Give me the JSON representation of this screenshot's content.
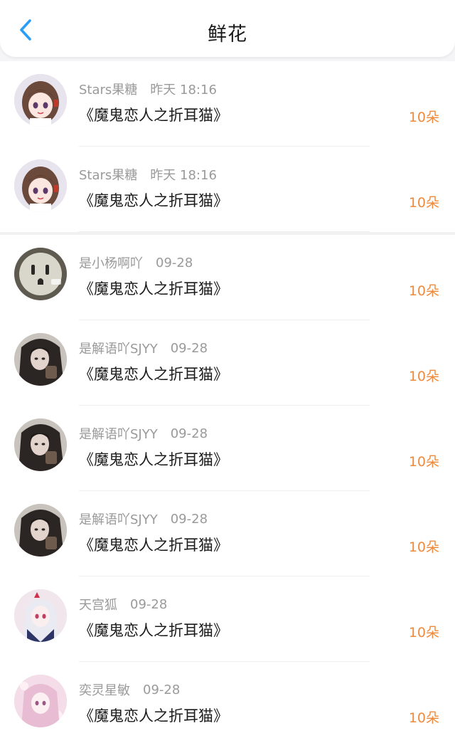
{
  "header": {
    "title": "鲜花",
    "back_icon": "chevron-left-icon",
    "accent_color": "#2a9df4"
  },
  "records": [
    {
      "user": "Stars果糖",
      "time": "昨天 18:16",
      "book": "《魔鬼恋人之折耳猫》",
      "amount": "10朵",
      "avatar": "anime-girl-brown-hair"
    },
    {
      "user": "Stars果糖",
      "time": "昨天 18:16",
      "book": "《魔鬼恋人之折耳猫》",
      "amount": "10朵",
      "avatar": "anime-girl-brown-hair"
    },
    {
      "user": "是小杨啊吖",
      "time": "09-28",
      "book": "《魔鬼恋人之折耳猫》",
      "amount": "10朵",
      "avatar": "power-outlet"
    },
    {
      "user": "是解语吖SJYY",
      "time": "09-28",
      "book": "《魔鬼恋人之折耳猫》",
      "amount": "10朵",
      "avatar": "dark-hair-girl"
    },
    {
      "user": "是解语吖SJYY",
      "time": "09-28",
      "book": "《魔鬼恋人之折耳猫》",
      "amount": "10朵",
      "avatar": "dark-hair-girl"
    },
    {
      "user": "是解语吖SJYY",
      "time": "09-28",
      "book": "《魔鬼恋人之折耳猫》",
      "amount": "10朵",
      "avatar": "dark-hair-girl"
    },
    {
      "user": "天宫狐",
      "time": "09-28",
      "book": "《魔鬼恋人之折耳猫》",
      "amount": "10朵",
      "avatar": "anime-white-hair"
    },
    {
      "user": "奕灵星敏",
      "time": "09-28",
      "book": "《魔鬼恋人之折耳猫》",
      "amount": "10朵",
      "avatar": "anime-pink-girl"
    }
  ],
  "colors": {
    "amount": "#ef8a3c",
    "meta_text": "#9a9a9a",
    "book_text": "#1b1b1b"
  }
}
